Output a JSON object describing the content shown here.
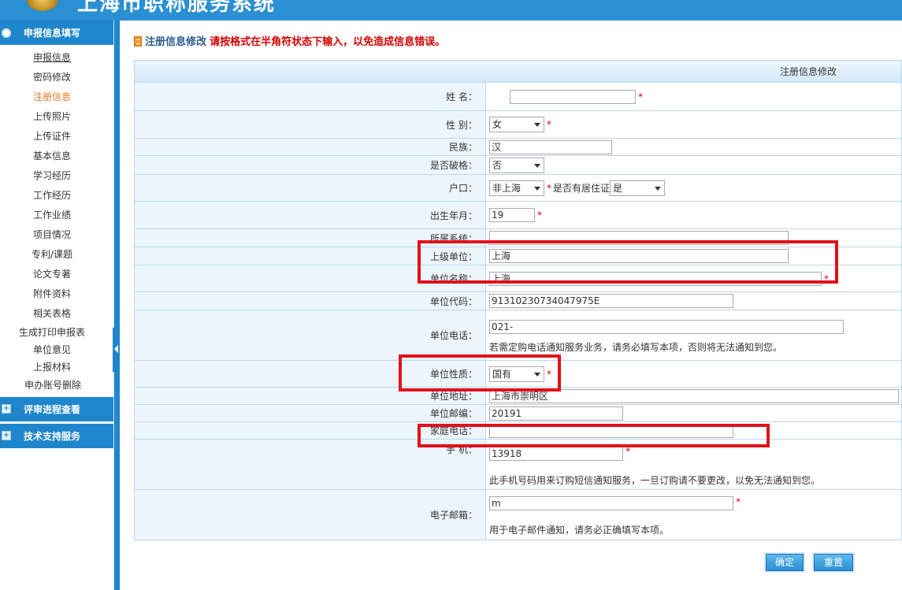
{
  "header": {
    "title": "上海市职称服务系统"
  },
  "sidebar": {
    "section1": "申报信息填写",
    "items": [
      "申报信息",
      "密码修改",
      "注册信息",
      "上传照片",
      "上传证件",
      "基本信息",
      "学习经历",
      "工作经历",
      "工作业绩",
      "项目情况",
      "专利/课题",
      "论文专著",
      "附件资料",
      "相关表格",
      "生成打印申报表",
      "单位意见",
      "上报材料",
      "申办账号删除"
    ],
    "section2": "评审进程查看",
    "section3": "技术支持服务"
  },
  "notice": {
    "label": "注册信息修改",
    "warning": "请按格式在半角符状态下输入，以免造成信息错误。"
  },
  "form": {
    "caption": "注册信息修改",
    "labels": {
      "name": "姓 名：",
      "gender": "性 别：",
      "ethnicity": "民族：",
      "exceptional": "是否破格：",
      "hukou": "户口：",
      "birth": "出生年月：",
      "system": "所属系统：",
      "superior": "上级单位：",
      "unit_name": "单位名称：",
      "unit_code": "单位代码：",
      "unit_phone": "单位电话：",
      "unit_type": "单位性质：",
      "unit_address": "单位地址：",
      "unit_zip": "单位邮编：",
      "home_phone": "家庭电话：",
      "mobile": "手 机：",
      "email": "电子邮箱："
    },
    "values": {
      "name": "",
      "gender": "女",
      "ethnicity": "汉",
      "exceptional": "否",
      "hukou": "非上海",
      "residence_label": "是否有居住证",
      "residence": "是",
      "birth": "19",
      "system": "",
      "superior": "上海",
      "unit_name": "上海",
      "unit_code": "91310230734047975E",
      "unit_phone": "021-",
      "unit_type": "国有",
      "unit_address": "上海市崇明区",
      "unit_zip": "20191",
      "home_phone": "",
      "mobile": "13918",
      "email": "m"
    },
    "hints": {
      "unit_phone": "若需定购电话通知服务业务，请务必填写本项，否则将无法通知到您。",
      "mobile": "此手机号码用来订购短信通知服务，一旦订购请不要更改，以免无法通知到您。",
      "email": "用于电子邮件通知，请务必正确填写本项。"
    },
    "required_mark": "*"
  },
  "buttons": {
    "confirm": "确定",
    "reset": "重置"
  },
  "colors": {
    "header": "#2a8fd3",
    "sidebar_head": "#1f86cc",
    "label_bg": "#edf5fc",
    "warning": "#d40000",
    "highlight_box": "#e0111b"
  }
}
